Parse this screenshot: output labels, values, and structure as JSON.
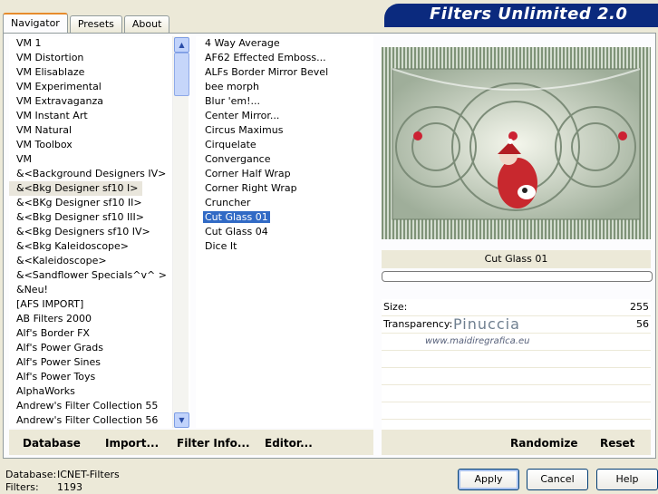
{
  "tabs": [
    "Navigator",
    "Presets",
    "About"
  ],
  "banner": {
    "title": "Filters Unlimited 2.0"
  },
  "categories": [
    "VM 1",
    "VM Distortion",
    "VM Elisablaze",
    "VM Experimental",
    "VM Extravaganza",
    "VM Instant Art",
    "VM Natural",
    "VM Toolbox",
    "VM",
    "&<Background Designers IV>",
    "&<Bkg Designer sf10 I>",
    "&<BKg Designer sf10 II>",
    "&<Bkg Designer sf10 III>",
    "&<Bkg Designers sf10 IV>",
    "&<Bkg Kaleidoscope>",
    "&<Kaleidoscope>",
    "&<Sandflower Specials^v^ >",
    "&Neu!",
    "[AFS IMPORT]",
    "AB Filters 2000",
    "Alf's Border FX",
    "Alf's Power Grads",
    "Alf's Power Sines",
    "Alf's Power Toys",
    "AlphaWorks",
    "Andrew's Filter Collection 55",
    "Andrew's Filter Collection 56"
  ],
  "selected_category": "&<Bkg Designer sf10 I>",
  "filters": [
    "4 Way Average",
    "AF62 Effected Emboss...",
    "ALFs Border Mirror Bevel",
    "bee morph",
    "Blur 'em!...",
    "Center Mirror...",
    "Circus Maximus",
    "Cirquelate",
    "Convergance",
    "Corner Half Wrap",
    "Corner Right Wrap",
    "Cruncher",
    "Cut Glass 01",
    "Cut Glass 04",
    "Dice It"
  ],
  "selected_filter": "Cut Glass 01",
  "filter_name": "Cut Glass 01",
  "progress": 0,
  "params": [
    {
      "label": "Size:",
      "value": "255"
    },
    {
      "label": "Transparency:",
      "value": "56"
    }
  ],
  "watermark": {
    "name": "Pinuccia",
    "url": "www.maidiregrafica.eu"
  },
  "toolbar": {
    "database": "Database",
    "import": "Import...",
    "filter_info": "Filter Info...",
    "editor": "Editor...",
    "randomize": "Randomize",
    "reset": "Reset"
  },
  "status": {
    "database_label": "Database:",
    "database_value": "ICNET-Filters",
    "filters_label": "Filters:",
    "filters_value": "1193"
  },
  "buttons": {
    "apply": "Apply",
    "cancel": "Cancel",
    "help": "Help"
  },
  "colors": {
    "banner": "#0b2a7e",
    "selection": "#316ac5",
    "tab_accent": "#e68b2c"
  }
}
